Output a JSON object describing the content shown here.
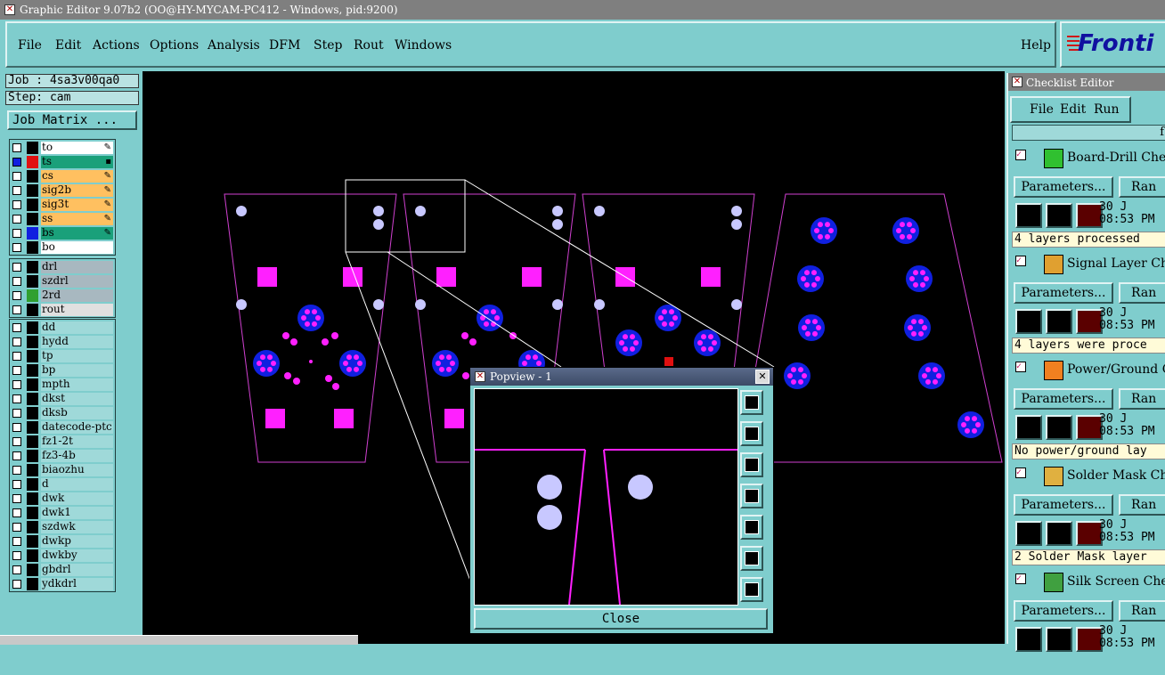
{
  "window": {
    "title": "Graphic Editor 9.07b2 (OO@HY-MYCAM-PC412 - Windows, pid:9200)"
  },
  "menu": [
    "File",
    "Edit",
    "Actions",
    "Options",
    "Analysis",
    "DFM",
    "Step",
    "Rout",
    "Windows"
  ],
  "help_label": "Help",
  "logo_text": "Fronti",
  "job": {
    "label": "Job : 4sa3v00qa0",
    "step": "Step: cam",
    "matrix_button": "Job Matrix ..."
  },
  "colors": {
    "canvas_bg": "#000000",
    "outline": "#d040d0",
    "pad": "#ff20ff",
    "hole": "#c8c8ff",
    "ring": "#1020e0"
  },
  "layers": {
    "board": [
      {
        "name": "to",
        "bg": "#ffffff",
        "swatch": "",
        "mark": "✎"
      },
      {
        "name": "ts",
        "bg": "#1aa07a",
        "swatch": "#e01010",
        "mark": "▪",
        "active": true
      },
      {
        "name": "cs",
        "bg": "#ffc060",
        "swatch": "",
        "mark": "✎"
      },
      {
        "name": "sig2b",
        "bg": "#ffc060",
        "swatch": "",
        "mark": "✎"
      },
      {
        "name": "sig3t",
        "bg": "#ffc060",
        "swatch": "",
        "mark": "✎"
      },
      {
        "name": "ss",
        "bg": "#ffc060",
        "swatch": "",
        "mark": "✎"
      },
      {
        "name": "bs",
        "bg": "#1aa07a",
        "swatch": "#1020e0",
        "mark": "✎"
      },
      {
        "name": "bo",
        "bg": "#ffffff",
        "swatch": "",
        "mark": ""
      }
    ],
    "drill": [
      {
        "name": "drl",
        "bg": "#a8b8c0",
        "swatch": "",
        "mark": ""
      },
      {
        "name": "szdrl",
        "bg": "#a8b8c0",
        "swatch": "",
        "mark": ""
      },
      {
        "name": "2rd",
        "bg": "#a8b8c0",
        "swatch": "#30a030",
        "mark": ""
      },
      {
        "name": "rout",
        "bg": "#e0e0e0",
        "swatch": "",
        "mark": ""
      }
    ],
    "misc": [
      {
        "name": "dd"
      },
      {
        "name": "hydd"
      },
      {
        "name": "tp"
      },
      {
        "name": "bp"
      },
      {
        "name": "mpth"
      },
      {
        "name": "dkst"
      },
      {
        "name": "dksb"
      },
      {
        "name": "datecode-ptc"
      },
      {
        "name": "fz1-2t"
      },
      {
        "name": "fz3-4b"
      },
      {
        "name": "biaozhu"
      },
      {
        "name": "d"
      },
      {
        "name": "dwk"
      },
      {
        "name": "dwk1"
      },
      {
        "name": "szdwk"
      },
      {
        "name": "dwkp"
      },
      {
        "name": "dwkby"
      },
      {
        "name": "gbdrl"
      },
      {
        "name": "ydkdrl"
      }
    ]
  },
  "popview": {
    "title": "Popview - 1",
    "close_label": "Close",
    "close_x": "✕"
  },
  "checklist": {
    "title": "Checklist Editor",
    "menu": [
      "File",
      "Edit",
      "Run"
    ],
    "header_char": "f",
    "actions": [
      {
        "name": "Board-Drill Che",
        "icon_color": "#30c030",
        "params": "Parameters...",
        "ranges": "Ran",
        "date": "30 J",
        "time": "08:53 PM",
        "status": "4 layers processed"
      },
      {
        "name": "Signal Layer Ch",
        "icon_color": "#e0a030",
        "params": "Parameters...",
        "ranges": "Ran",
        "date": "30 J",
        "time": "08:53 PM",
        "status": "4 layers were proce"
      },
      {
        "name": "Power/Ground Cl",
        "icon_color": "#f08020",
        "params": "Parameters...",
        "ranges": "Ran",
        "date": "30 J",
        "time": "08:53 PM",
        "status": "No power/ground lay"
      },
      {
        "name": "Solder Mask Che",
        "icon_color": "#e0b040",
        "params": "Parameters...",
        "ranges": "Ran",
        "date": "30 J",
        "time": "08:53 PM",
        "status": "2 Solder Mask layer"
      },
      {
        "name": "Silk Screen Che",
        "icon_color": "#40a040",
        "params": "Parameters...",
        "ranges": "Ran",
        "date": "30 J",
        "time": "08:53 PM",
        "status": ""
      }
    ]
  }
}
